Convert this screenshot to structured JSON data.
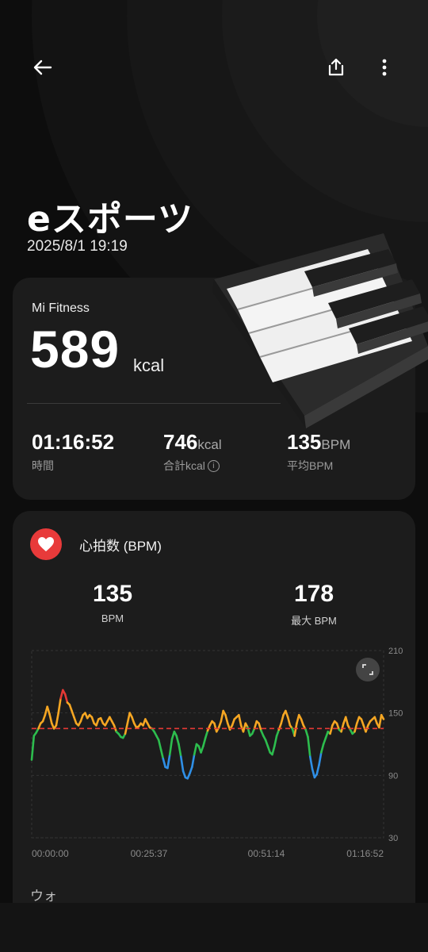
{
  "header": {
    "back_icon": "arrow-left-icon",
    "share_icon": "share-icon",
    "more_icon": "more-vertical-icon"
  },
  "activity": {
    "title": "eスポーツ",
    "datetime": "2025/8/1 19:19"
  },
  "summary": {
    "source": "Mi Fitness",
    "calories": "589",
    "calories_unit": "kcal",
    "stats": [
      {
        "value": "01:16:52",
        "unit": "",
        "label": "時間"
      },
      {
        "value": "746",
        "unit": "kcal",
        "label": "合計kcal"
      },
      {
        "value": "135",
        "unit": "BPM",
        "label": "平均BPM"
      }
    ]
  },
  "heart_rate": {
    "title": "心拍数 (BPM)",
    "avg_value": "135",
    "avg_label": "BPM",
    "max_value": "178",
    "max_label": "最大 BPM"
  },
  "chart_data": {
    "type": "line",
    "title": "",
    "x_ticks": [
      "00:00:00",
      "00:25:37",
      "00:51:14",
      "01:16:52"
    ],
    "y_ticks": [
      "210",
      "150",
      "90",
      "30"
    ],
    "ylim": [
      30,
      210
    ],
    "xlim_minutes": [
      0,
      76.87
    ],
    "average_line": 135,
    "colors": {
      "orange": "#f5a623",
      "green": "#2dbd4e",
      "blue": "#2f8fe6",
      "red": "#e53935",
      "avg": "#e53935"
    },
    "series": [
      {
        "values": [
          105,
          128,
          131,
          135,
          140,
          142,
          148,
          156,
          149,
          140,
          135,
          138,
          150,
          164,
          172,
          168,
          160,
          158,
          152,
          146,
          140,
          138,
          142,
          148,
          150,
          145,
          148,
          146,
          140,
          138,
          144,
          145,
          140,
          138,
          142,
          146,
          142,
          138,
          132,
          130,
          127,
          126,
          130,
          140,
          150,
          146,
          140,
          136,
          137,
          140,
          138,
          144,
          140,
          136,
          135,
          132,
          128,
          124,
          115,
          106,
          98,
          97,
          110,
          125,
          132,
          128,
          120,
          108,
          94,
          88,
          87,
          92,
          98,
          110,
          120,
          118,
          112,
          118,
          126,
          133,
          138,
          142,
          140,
          132,
          136,
          142,
          152,
          148,
          140,
          134,
          138,
          144,
          146,
          148,
          138,
          132,
          140,
          136,
          128,
          130,
          135,
          142,
          140,
          133,
          128,
          124,
          118,
          112,
          110,
          118,
          128,
          134,
          140,
          148,
          152,
          146,
          138,
          135,
          128,
          140,
          148,
          144,
          138,
          134,
          127,
          108,
          96,
          88,
          91,
          100,
          112,
          120,
          126,
          132,
          130,
          138,
          142,
          140,
          134,
          132,
          140,
          146,
          138,
          134,
          130,
          132,
          140,
          146,
          144,
          138,
          132,
          138,
          142,
          144,
          146,
          140,
          136,
          148,
          144
        ]
      }
    ]
  },
  "footer": {
    "section_peek": "ウォ"
  }
}
